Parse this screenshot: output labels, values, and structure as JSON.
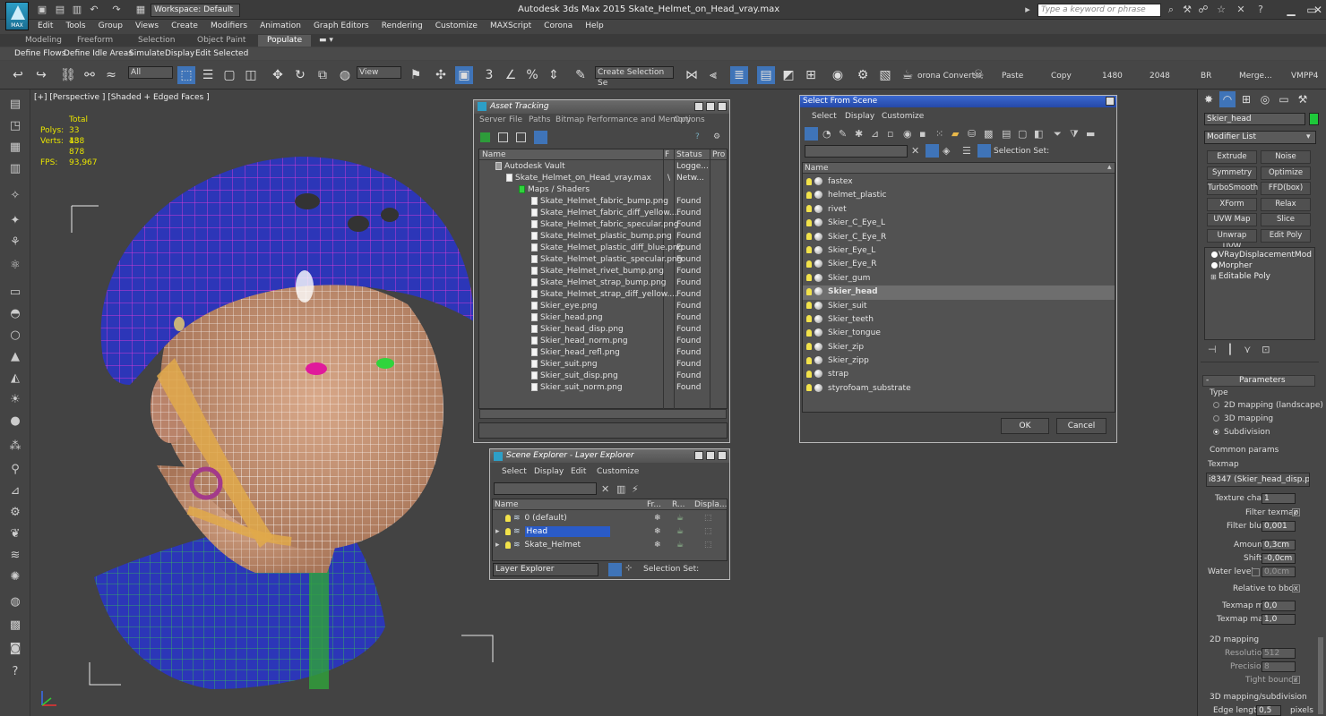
{
  "title_bar": {
    "workspace": "Workspace: Default",
    "app_title": "Autodesk 3ds Max  2015     Skate_Helmet_on_Head_vray.max",
    "search_placeholder": "Type a keyword or phrase",
    "logo_text": "MAX"
  },
  "menu": [
    "Edit",
    "Tools",
    "Group",
    "Views",
    "Create",
    "Modifiers",
    "Animation",
    "Graph Editors",
    "Rendering",
    "Customize",
    "MAXScript",
    "Corona",
    "Help"
  ],
  "ribbon_tabs": [
    "Modeling",
    "Freeform",
    "Selection",
    "Object Paint",
    "Populate"
  ],
  "ribbon_sub": [
    "Define Flows",
    "Define Idle Areas",
    "Simulate",
    "Display",
    "Edit Selected"
  ],
  "toolbar": {
    "filter": "All",
    "view": "View",
    "named_sel": "Create Selection Se",
    "corona": "orona Convert",
    "paste": "Paste",
    "copy": "Copy",
    "w": "1480",
    "h": "2048",
    "br": "BR",
    "merge": "Merge...",
    "vmpp": "VMPP4"
  },
  "viewport": {
    "label": "[+] [Perspective ] [Shaded + Edged Faces ]",
    "stats_total": "Total",
    "polys_label": "Polys:",
    "polys": "33 438",
    "verts_label": "Verts:",
    "verts": "18 878",
    "fps_label": "FPS:",
    "fps": "93,967"
  },
  "asset": {
    "title": "Asset Tracking",
    "menu": [
      "Server",
      "File",
      "Paths",
      "Bitmap Performance and Memory",
      "Options"
    ],
    "cols": [
      "Name",
      "F",
      "Status",
      "Pro"
    ],
    "rows": [
      {
        "n": "Autodesk Vault",
        "s": "Logge...",
        "f": "",
        "i": 0
      },
      {
        "n": "Skate_Helmet_on_Head_vray.max",
        "s": "Netw...",
        "f": "\\",
        "i": 1
      },
      {
        "n": "Maps / Shaders",
        "s": "",
        "f": "",
        "i": 2
      },
      {
        "n": "Skate_Helmet_fabric_bump.png",
        "s": "Found",
        "f": "",
        "i": 3
      },
      {
        "n": "Skate_Helmet_fabric_diff_yellow....",
        "s": "Found",
        "f": "",
        "i": 3
      },
      {
        "n": "Skate_Helmet_fabric_specular.png",
        "s": "Found",
        "f": "",
        "i": 3
      },
      {
        "n": "Skate_Helmet_plastic_bump.png",
        "s": "Found",
        "f": "",
        "i": 3
      },
      {
        "n": "Skate_Helmet_plastic_diff_blue.png",
        "s": "Found",
        "f": "",
        "i": 3
      },
      {
        "n": "Skate_Helmet_plastic_specular.png",
        "s": "Found",
        "f": "",
        "i": 3
      },
      {
        "n": "Skate_Helmet_rivet_bump.png",
        "s": "Found",
        "f": "",
        "i": 3
      },
      {
        "n": "Skate_Helmet_strap_bump.png",
        "s": "Found",
        "f": "",
        "i": 3
      },
      {
        "n": "Skate_Helmet_strap_diff_yellow....",
        "s": "Found",
        "f": "",
        "i": 3
      },
      {
        "n": "Skier_eye.png",
        "s": "Found",
        "f": "",
        "i": 3
      },
      {
        "n": "Skier_head.png",
        "s": "Found",
        "f": "",
        "i": 3
      },
      {
        "n": "Skier_head_disp.png",
        "s": "Found",
        "f": "",
        "i": 3
      },
      {
        "n": "Skier_head_norm.png",
        "s": "Found",
        "f": "",
        "i": 3
      },
      {
        "n": "Skier_head_refl.png",
        "s": "Found",
        "f": "",
        "i": 3
      },
      {
        "n": "Skier_suit.png",
        "s": "Found",
        "f": "",
        "i": 3
      },
      {
        "n": "Skier_suit_disp.png",
        "s": "Found",
        "f": "",
        "i": 3
      },
      {
        "n": "Skier_suit_norm.png",
        "s": "Found",
        "f": "",
        "i": 3
      }
    ]
  },
  "scene": {
    "title": "Scene Explorer - Layer Explorer",
    "menu": [
      "Select",
      "Display",
      "Edit",
      "Customize"
    ],
    "cols": [
      "Name",
      "Fr...",
      "R...",
      "Displa..."
    ],
    "rows": [
      {
        "n": "0 (default)",
        "sel": false
      },
      {
        "n": "Head",
        "sel": true
      },
      {
        "n": "Skate_Helmet",
        "sel": false
      }
    ],
    "footer_drop": "Layer Explorer",
    "footer_sel": "Selection Set:"
  },
  "select": {
    "title": "Select From Scene",
    "menu": [
      "Select",
      "Display",
      "Customize"
    ],
    "selset": "Selection Set:",
    "col": "Name",
    "items": [
      "fastex",
      "helmet_plastic",
      "rivet",
      "Skier_C_Eye_L",
      "Skier_C_Eye_R",
      "Skier_Eye_L",
      "Skier_Eye_R",
      "Skier_gum",
      "Skier_head",
      "Skier_suit",
      "Skier_teeth",
      "Skier_tongue",
      "Skier_zip",
      "Skier_zipp",
      "strap",
      "styrofoam_substrate"
    ],
    "selected": "Skier_head",
    "ok": "OK",
    "cancel": "Cancel"
  },
  "cmd": {
    "object_name": "Skier_head",
    "modifier_list": "Modifier List",
    "buttons": [
      "Extrude",
      "Noise",
      "Symmetry",
      "Optimize",
      "TurboSmooth",
      "FFD(box)",
      "XForm",
      "Relax",
      "UVW Map",
      "Slice",
      "Unwrap UVW",
      "Edit Poly"
    ],
    "stack": [
      "VRayDisplacementMod",
      "Morpher",
      "Editable Poly"
    ],
    "parameters": "Parameters",
    "type": "Type",
    "type_opts": [
      "2D mapping (landscape)",
      "3D mapping",
      "Subdivision"
    ],
    "common": "Common params",
    "texmap": "Texmap",
    "texmap_val": "i8347 (Skier_head_disp.png)",
    "tex_chan_l": "Texture chan",
    "tex_chan": "1",
    "filter_texmap": "Filter texmap",
    "filter_blur_l": "Filter blur",
    "filter_blur": "0,001",
    "amount_l": "Amount",
    "amount": "0,3cm",
    "shift_l": "Shift",
    "shift": "-0,0cm",
    "water_l": "Water level",
    "water": "0,0cm",
    "rel_bbox": "Relative to bbox",
    "tmin_l": "Texmap min",
    "tmin": "0,0",
    "tmax_l": "Texmap max",
    "tmax": "1,0",
    "map2d": "2D mapping",
    "res_l": "Resolution",
    "res": "512",
    "prec_l": "Precision",
    "prec": "8",
    "tight": "Tight bounds",
    "map3d": "3D mapping/subdivision",
    "edge_l": "Edge length",
    "edge": "0,5",
    "pixels": "pixels"
  },
  "colors": {
    "selected_row": "#2a5bc7",
    "helmet": "#2c36b8",
    "wire_helmet": "#e03ad8"
  }
}
